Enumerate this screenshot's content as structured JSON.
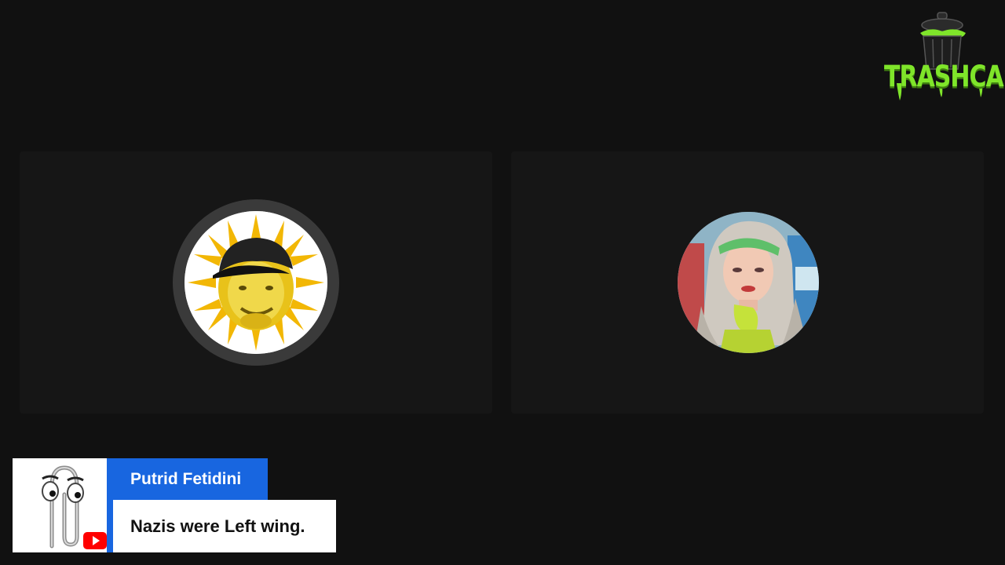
{
  "logo": {
    "text": "TRASHCAST",
    "icon": "trash-can-icon",
    "color": "#7fe52a"
  },
  "participants": [
    {
      "id": "left",
      "avatar": "sun-face-avatar",
      "speaking_ring": true
    },
    {
      "id": "right",
      "avatar": "cosplay-portrait-avatar",
      "speaking_ring": false
    }
  ],
  "chat": {
    "platform_icon": "youtube-icon",
    "avatar": "paperclip-avatar",
    "username": "Putrid Fetidini",
    "message": "Nazis were Left wing.",
    "accent_color": "#1866e0"
  }
}
